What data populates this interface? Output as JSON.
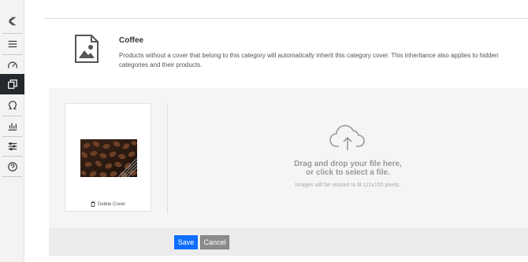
{
  "sidebar": {
    "items": [
      {
        "icon": "logo-icon"
      },
      {
        "icon": "menu-icon"
      },
      {
        "icon": "dashboard-icon"
      },
      {
        "icon": "catalog-icon",
        "active": true
      },
      {
        "icon": "customers-icon"
      },
      {
        "icon": "stats-icon"
      },
      {
        "icon": "settings-icon"
      },
      {
        "icon": "help-icon"
      }
    ]
  },
  "category": {
    "title": "Coffee",
    "description": "Products without a cover that belong to this category will automatically inherit this category cover. This inheritance also applies to hidden categories and their products."
  },
  "cover": {
    "delete_label": "Delete Cover"
  },
  "dropzone": {
    "title_line1": "Drag and drop your file here,",
    "title_line2": "or click to select a file.",
    "hint": "Images will be resized to fit 111x155 pixels."
  },
  "actions": {
    "save_label": "Save",
    "cancel_label": "Cancel"
  },
  "colors": {
    "primary": "#0d6efd",
    "sidebar_active": "#25282d",
    "cancel": "#8c8c8c"
  }
}
